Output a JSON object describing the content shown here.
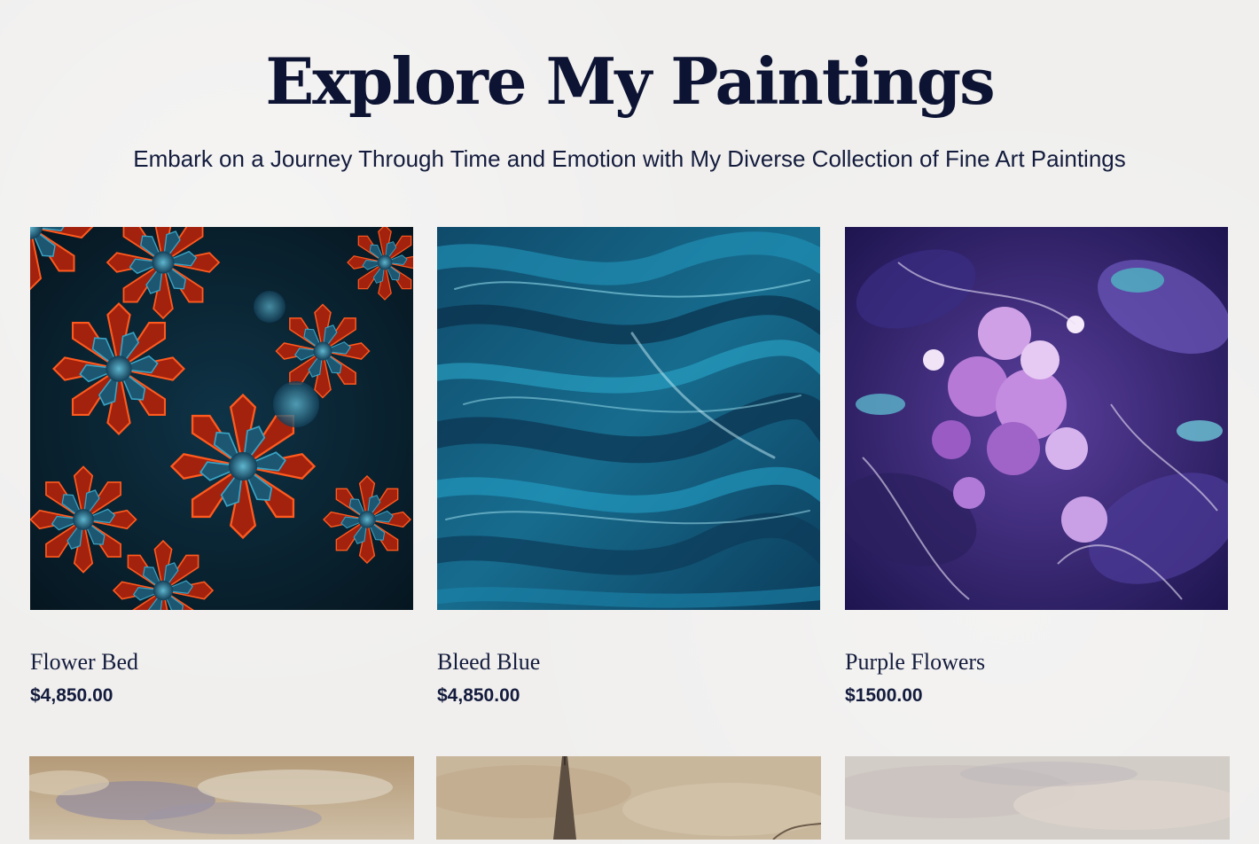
{
  "header": {
    "title": "Explore My Paintings",
    "subtitle": "Embark on a Journey Through Time and Emotion with My Diverse Collection of Fine Art Paintings"
  },
  "paintings": [
    {
      "name": "Flower Bed",
      "price": "$4,850.00",
      "image": "red-blue-succulent-flowers-painting"
    },
    {
      "name": "Bleed Blue",
      "price": "$4,850.00",
      "image": "blue-brushstroke-abstract-painting"
    },
    {
      "name": "Purple Flowers",
      "price": "$1500.00",
      "image": "purple-fluid-floral-painting"
    }
  ],
  "next_row_images": [
    "cloudy-sky-landscape-painting",
    "church-spire-sepia-painting",
    "pale-watercolor-painting"
  ],
  "colors": {
    "background": "#f0efee",
    "text": "#0d1433"
  }
}
